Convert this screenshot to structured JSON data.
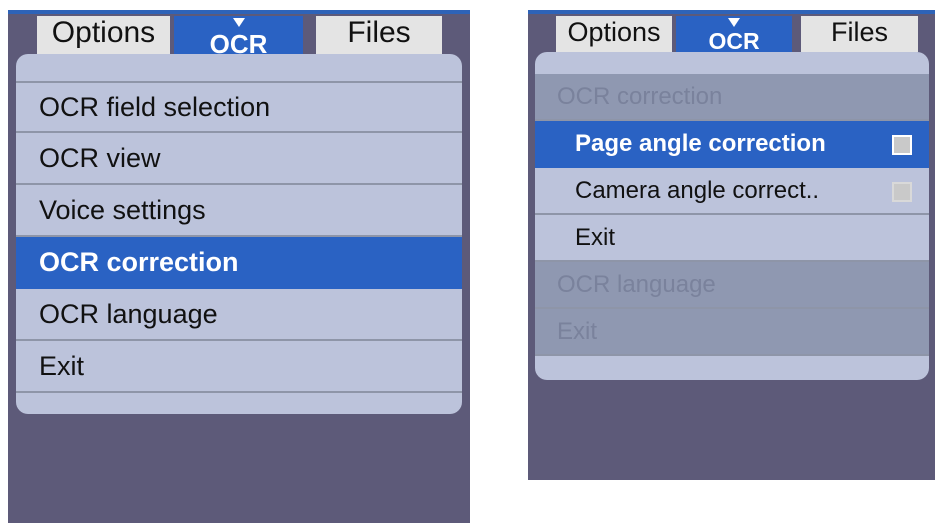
{
  "left_screen": {
    "tabs": {
      "options": "Options",
      "ocr": "OCR",
      "files": "Files"
    },
    "menu": [
      {
        "label": "OCR field selection"
      },
      {
        "label": "OCR view"
      },
      {
        "label": "Voice settings"
      },
      {
        "label": "OCR correction",
        "selected": true
      },
      {
        "label": "OCR language"
      },
      {
        "label": "Exit"
      }
    ]
  },
  "right_screen": {
    "tabs": {
      "options": "Options",
      "ocr": "OCR",
      "files": "Files"
    },
    "menu": [
      {
        "label": "OCR correction",
        "state": "disabled"
      },
      {
        "label": "Page angle correction",
        "selected": true,
        "checkbox": false
      },
      {
        "label": "Camera angle correct..",
        "checkbox": false
      },
      {
        "label": "Exit"
      },
      {
        "label": "OCR language",
        "state": "disabled"
      },
      {
        "label": "Exit",
        "state": "disabled"
      }
    ]
  },
  "colors": {
    "device_background": "#5d5a79",
    "panel": "#bcc3db",
    "selection": "#2a62c3",
    "disabled_row": "#8f98b1",
    "tab_inactive": "#e4e4e4"
  }
}
